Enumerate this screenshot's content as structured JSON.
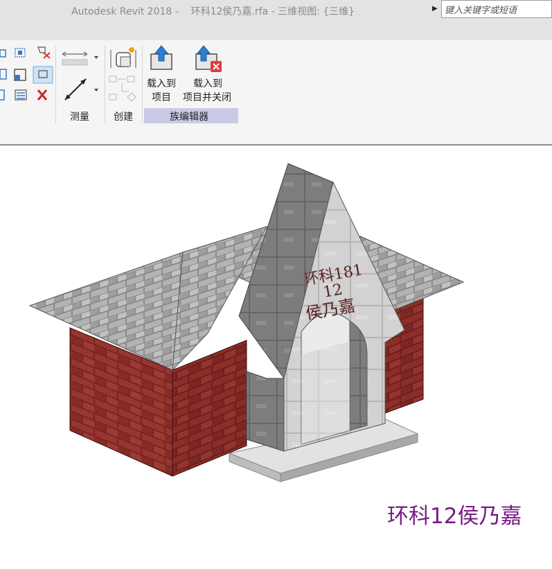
{
  "titlebar": {
    "title": "Autodesk Revit 2018 -    环科12侯乃嘉.rfa - 三维视图: {三维}",
    "search_placeholder": "键入关键字或短语"
  },
  "ribbon": {
    "panels": {
      "measure": "测量",
      "create": "创建",
      "family_editor": "族编辑器"
    },
    "buttons": {
      "load_into_project_line1": "载入到",
      "load_into_project_line2": "项目",
      "load_close_line1": "载入到",
      "load_close_line2": "项目并关闭"
    },
    "highlight_color": "#c9cbe6"
  },
  "model": {
    "gable_text_line1": "环科181",
    "gable_text_line2": "12",
    "gable_text_line3": "侯乃嘉",
    "brick_color": "#8b2a26",
    "stone_color": "#cfcfcf",
    "roof_color": "#8e8e8e"
  },
  "watermark": {
    "text": "环科12侯乃嘉",
    "color": "#7a1a86"
  }
}
